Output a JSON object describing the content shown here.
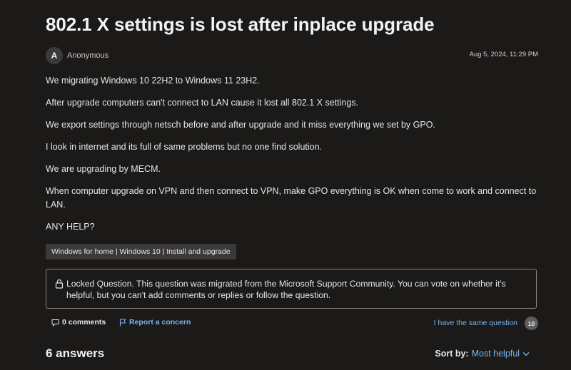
{
  "question": {
    "title": "802.1 X settings is lost after inplace upgrade",
    "author": {
      "avatar_initial": "A",
      "name": "Anonymous"
    },
    "date": "Aug 5, 2024, 11:29 PM",
    "paragraphs": [
      "We migrating Windows 10 22H2 to Windows 11 23H2.",
      "After upgrade computers can't connect to LAN cause it lost all 802.1 X settings.",
      "We export settings through netsch before and after upgrade and it miss everything we set by GPO.",
      "I look in internet and its full of same problems but no one find solution.",
      "We are upgrading by MECM.",
      "When computer upgrade on VPN and then connect to VPN, make GPO everything is OK when come to work and connect to LAN.",
      "ANY HELP?"
    ],
    "tag": "Windows for home | Windows 10 | Install and upgrade"
  },
  "locked_notice": {
    "icon": "lock-icon",
    "text": "Locked Question. This question was migrated from the Microsoft Support Community. You can vote on whether it's helpful, but you can't add comments or replies or follow the question."
  },
  "actions": {
    "comments_label": "0 comments",
    "report_label": "Report a concern",
    "same_question_label": "I have the same question",
    "same_question_count": "10"
  },
  "answers": {
    "heading": "6 answers",
    "sort_label": "Sort by:",
    "sort_value": "Most helpful"
  },
  "colors": {
    "background": "#1b1a19",
    "link": "#79b4f0",
    "badge": "#605e5c"
  }
}
